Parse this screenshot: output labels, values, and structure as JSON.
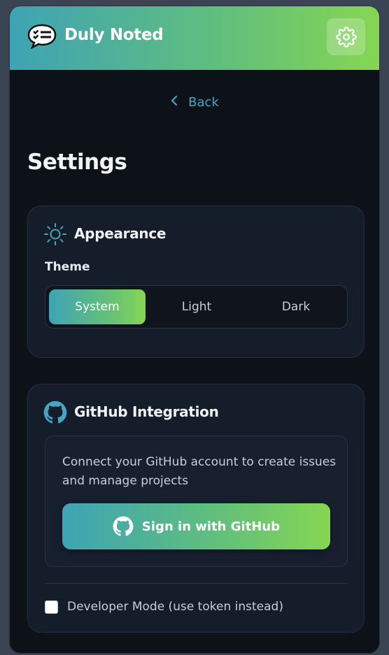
{
  "app": {
    "title": "Duly Noted"
  },
  "header": {
    "settings_icon": "gear-icon",
    "logo_icon": "speech-bubble-checklist-icon"
  },
  "nav": {
    "back_label": "Back",
    "back_icon": "chevron-left-icon"
  },
  "page": {
    "title": "Settings"
  },
  "appearance": {
    "title": "Appearance",
    "icon": "sun-icon",
    "theme_label": "Theme",
    "options": [
      "System",
      "Light",
      "Dark"
    ],
    "selected": "System"
  },
  "github": {
    "title": "GitHub Integration",
    "icon": "github-icon",
    "description": "Connect your GitHub account to create issues and manage projects",
    "sign_in_label": "Sign in with GitHub",
    "dev_mode_label": "Developer Mode (use token instead)",
    "dev_mode_checked": false
  },
  "colors": {
    "accent_start": "#3ea3b5",
    "accent_end": "#86d652",
    "background": "#0d1118",
    "card": "#161d2a",
    "link": "#45a6c4"
  }
}
